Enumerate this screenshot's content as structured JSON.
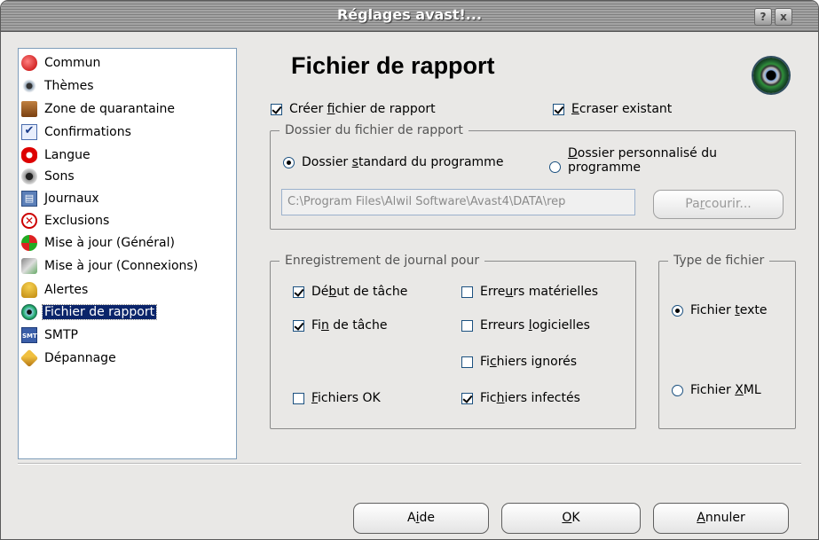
{
  "window": {
    "title": "Réglages avast!...",
    "help_glyph": "?",
    "close_glyph": "x"
  },
  "nav": {
    "items": [
      {
        "label": "Commun",
        "icon": "commun-icon"
      },
      {
        "label": "Thèmes",
        "icon": "themes-icon"
      },
      {
        "label": "Zone de quarantaine",
        "icon": "quarantine-icon"
      },
      {
        "label": "Confirmations",
        "icon": "confirmations-icon"
      },
      {
        "label": "Langue",
        "icon": "language-icon"
      },
      {
        "label": "Sons",
        "icon": "sounds-icon"
      },
      {
        "label": "Journaux",
        "icon": "logs-icon"
      },
      {
        "label": "Exclusions",
        "icon": "exclusions-icon"
      },
      {
        "label": "Mise à jour (Général)",
        "icon": "update-icon"
      },
      {
        "label": "Mise à jour (Connexions)",
        "icon": "connections-icon"
      },
      {
        "label": "Alertes",
        "icon": "alerts-icon"
      },
      {
        "label": "Fichier de rapport",
        "icon": "avast-icon",
        "selected": true
      },
      {
        "label": "SMTP",
        "icon": "smtp-icon",
        "icon_text": "SMTP"
      },
      {
        "label": "Dépannage",
        "icon": "troubleshooting-icon"
      }
    ]
  },
  "page": {
    "heading": "Fichier de rapport",
    "create_report": {
      "pre": "Créer ",
      "key": "f",
      "post": "ichier de rapport",
      "checked": true
    },
    "overwrite": {
      "pre": "",
      "key": "E",
      "post": "craser existant",
      "checked": true
    },
    "folder_group": {
      "title": "Dossier du fichier de rapport",
      "standard": {
        "pre": "Dossier ",
        "key": "s",
        "post": "tandard du programme",
        "selected": true
      },
      "custom": {
        "pre": "",
        "key": "D",
        "post": "ossier personnalisé du programme",
        "selected": false
      },
      "path_value": "C:\\Program Files\\Alwil Software\\Avast4\\DATA\\rep",
      "browse": {
        "pre": "Pa",
        "key": "r",
        "post": "courir..."
      }
    },
    "logging_group": {
      "title": "Enregistrement de journal pour",
      "task_start": {
        "pre": "Dé",
        "key": "b",
        "post": "ut de tâche",
        "checked": true
      },
      "task_end": {
        "pre": "Fi",
        "key": "n",
        "post": " de tâche",
        "checked": true
      },
      "files_ok": {
        "pre": "",
        "key": "F",
        "post": "ichiers OK",
        "checked": false
      },
      "hw_errors": {
        "pre": "Erre",
        "key": "u",
        "post": "rs matérielles",
        "checked": false
      },
      "sw_errors": {
        "pre": "Erreurs ",
        "key": "l",
        "post": "ogicielles",
        "checked": false
      },
      "ignored_files": {
        "pre": "Fi",
        "key": "c",
        "post": "hiers ignorés",
        "checked": false
      },
      "infected_files": {
        "pre": "Fic",
        "key": "h",
        "post": "iers infectés",
        "checked": true
      }
    },
    "filetype_group": {
      "title": "Type de fichier",
      "text": {
        "pre": "Fichier ",
        "key": "t",
        "post": "exte",
        "selected": true
      },
      "xml": {
        "pre": "Fichier ",
        "key": "X",
        "post": "ML",
        "selected": false
      }
    }
  },
  "footer": {
    "help": {
      "pre": "A",
      "key": "i",
      "post": "de"
    },
    "ok": {
      "pre": "",
      "key": "O",
      "post": "K"
    },
    "cancel": {
      "pre": "",
      "key": "A",
      "post": "nnuler"
    }
  }
}
